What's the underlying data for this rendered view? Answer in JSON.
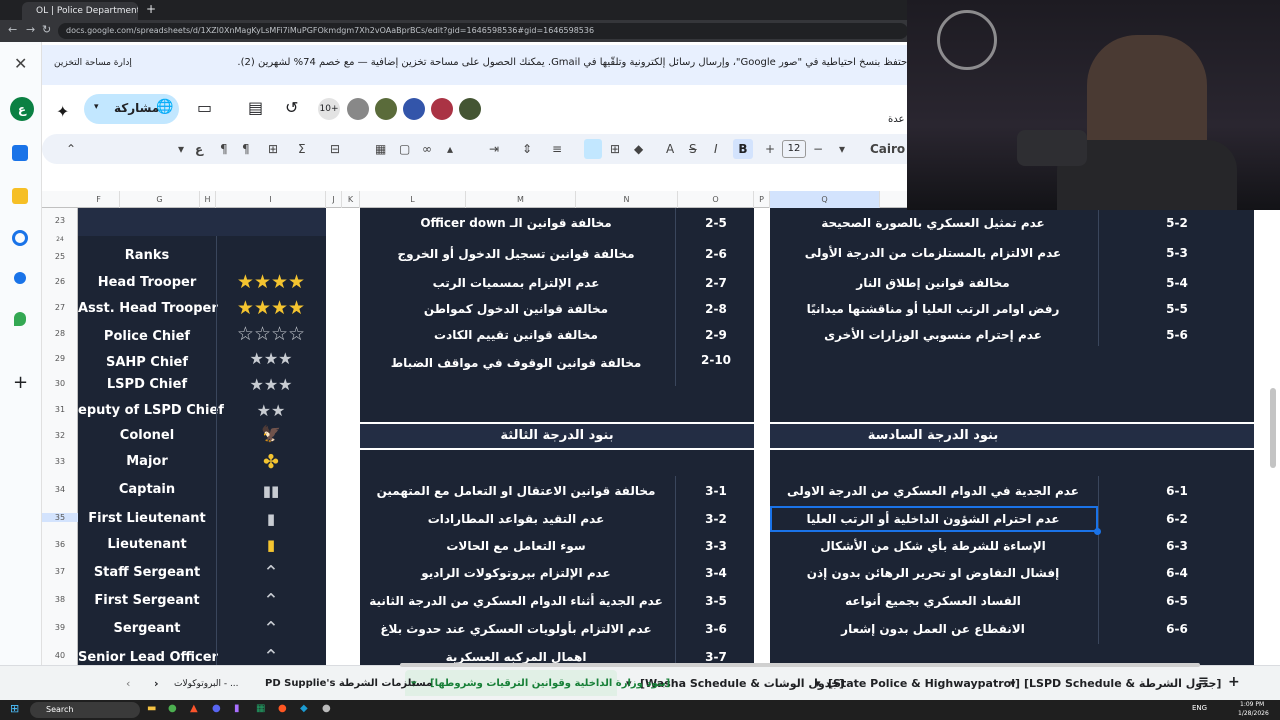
{
  "browser": {
    "tab_title": "OL | Police Department v2.0 -",
    "url": "docs.google.com/spreadsheets/d/1XZl0XnMagKyLsMFi7iMuPGFOkmdgm7Xh2vOAaBprBCs/edit?gid=1646598536#gid=1646598536"
  },
  "banner": {
    "message": "احتفظ بنسخ احتياطية في \"صور Google\"، وإرسال رسائل إلكترونية وتلقّيها في Gmail. يمكنك الحصول على مساحة تخزين إضافية — مع خصم 74% لشهرين (2).",
    "storage_link": "إدارة مساحة التخزين"
  },
  "toolbar": {
    "share_label": "مشاركة",
    "collab_count": "10+",
    "font": "Cairo",
    "font_size": "12",
    "partial_label": "عدة"
  },
  "columns": [
    "F",
    "G",
    "H",
    "I",
    "J",
    "K",
    "L",
    "M",
    "N",
    "O",
    "P",
    "Q"
  ],
  "rows": [
    "23",
    "24",
    "25",
    "26",
    "27",
    "28",
    "29",
    "30",
    "31",
    "32",
    "33",
    "34",
    "35",
    "36",
    "37",
    "38",
    "39",
    "40"
  ],
  "ranks": {
    "header": "Ranks",
    "items": [
      {
        "name": "Head Trooper",
        "insignia": "★★★★"
      },
      {
        "name": "Asst. Head Trooper",
        "insignia": "★★★★"
      },
      {
        "name": "Police Chief",
        "insignia": "☆☆☆☆"
      },
      {
        "name": "SAHP Chief",
        "insignia": "★★★"
      },
      {
        "name": "LSPD Chief",
        "insignia": "★★★"
      },
      {
        "name": "eputy of LSPD Chief",
        "insignia": "★★"
      },
      {
        "name": "Colonel",
        "insignia": "🦅"
      },
      {
        "name": "Major",
        "insignia": "✤"
      },
      {
        "name": "Captain",
        "insignia": "▮▮"
      },
      {
        "name": "First Lieutenant",
        "insignia": "▮"
      },
      {
        "name": "Lieutenant",
        "insignia": "▮"
      },
      {
        "name": "Staff Sergeant",
        "insignia": "⌃"
      },
      {
        "name": "First Sergeant",
        "insignia": "⌃"
      },
      {
        "name": "Sergeant",
        "insignia": "⌃"
      },
      {
        "name": "Senior Lead Officer",
        "insignia": "⌃"
      }
    ]
  },
  "second_degree": [
    {
      "code": "2-5",
      "text": "مخالفة قوانين الـ Officer down"
    },
    {
      "code": "2-6",
      "text": "مخالفة قوانين تسجيل الدخول أو الخروج"
    },
    {
      "code": "2-7",
      "text": "عدم الإلتزام بمسميات الرتب"
    },
    {
      "code": "2-8",
      "text": "مخالفة قوانين الدخول كمواطن"
    },
    {
      "code": "2-9",
      "text": "مخالفة قوانين تقييم الكادت"
    },
    {
      "code": "2-10",
      "text": "مخالفة قوانين الوقوف في مواقف الضباط"
    }
  ],
  "third_degree": {
    "header": "بنود الدرجة الثالثة",
    "items": [
      {
        "code": "3-1",
        "text": "مخالفة قوانين الاعتقال او التعامل مع المتهمين"
      },
      {
        "code": "3-2",
        "text": "عدم التقيد بقواعد المطارادات"
      },
      {
        "code": "3-3",
        "text": "سوء التعامل مع الحالات"
      },
      {
        "code": "3-4",
        "text": "عدم الإلتزام بپروتوكولات الراديو"
      },
      {
        "code": "3-5",
        "text": "عدم الجدية أثناء الدوام العسكري من الدرجة الثانية"
      },
      {
        "code": "3-6",
        "text": "عدم الالتزام  بأولويات العسكري عند حدوث بلاغ"
      },
      {
        "code": "3-7",
        "text": "اهمال المركبه العسكرية"
      }
    ]
  },
  "fifth_degree": [
    {
      "code": "5-2",
      "text": "عدم تمثيل العسكري بالصورة الصحيحة"
    },
    {
      "code": "5-3",
      "text": "عدم الالتزام بالمستلزمات من الدرجة الأولى"
    },
    {
      "code": "5-4",
      "text": "مخالفة قوانين إطلاق النار"
    },
    {
      "code": "5-5",
      "text": "رفض اوامر الرتب العليا أو مناقشتها ميدانيًا"
    },
    {
      "code": "5-6",
      "text": "عدم إحترام منسوبي الوزارات الأخرى"
    }
  ],
  "sixth_degree": {
    "header": "بنود الدرجة السادسة",
    "items": [
      {
        "code": "6-1",
        "text": "عدم الجدية في الدوام العسكري من الدرجة الاولى"
      },
      {
        "code": "6-2",
        "text": "عدم احترام الشؤون الداخلية أو الرتب العليا"
      },
      {
        "code": "6-3",
        "text": "الإساءة للشرطة بأي شكل من الأشكال"
      },
      {
        "code": "6-4",
        "text": "إفشال التفاوض او تحرير الرهائن بدون إذن"
      },
      {
        "code": "6-5",
        "text": "الفساد العسكري بجميع أنواعه"
      },
      {
        "code": "6-6",
        "text": "الانقطاع عن العمل بدون إشعار"
      }
    ]
  },
  "sheet_tabs": [
    "البروتوكولات - ...",
    "PD Supplie's مستلزمات الشرطة",
    "[بنود وزارة الداخلية وقوانين الترقيات وشروطها]",
    "[Washa Schedule & جدول الوشات]",
    "[State Police & Highwaypatrol]",
    "[LSPD Schedule & جدول الشرطة]"
  ],
  "taskbar": {
    "search": "Search",
    "lang": "ENG",
    "time": "1:09 PM",
    "date": "1/28/2026"
  },
  "colors": {
    "dark_cell": "#1c2434",
    "header_cell": "#232d44",
    "gold": "#f4c430",
    "selection": "#1a73e8"
  }
}
